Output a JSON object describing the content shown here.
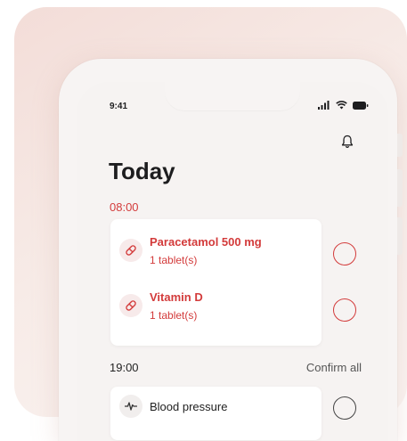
{
  "status_bar": {
    "time": "9:41",
    "signal_icon": "signal-bars-icon",
    "wifi_icon": "wifi-icon",
    "battery_icon": "battery-icon"
  },
  "header": {
    "title": "Today",
    "bell_icon": "bell-icon"
  },
  "colors": {
    "accent": "#d33b3b",
    "text": "#1d1d1f",
    "muted": "#555555",
    "check_neutral": "#444444"
  },
  "groups": [
    {
      "time": "08:00",
      "items": [
        {
          "name": "Paracetamol 500 mg",
          "dose": "1 tablet(s)",
          "icon": "pill-icon"
        },
        {
          "name": "Vitamin D",
          "dose": "1 tablet(s)",
          "icon": "pill-icon"
        }
      ]
    },
    {
      "time": "19:00",
      "confirm_all": "Confirm all",
      "items": [
        {
          "name": "Blood pressure",
          "icon": "pulse-icon"
        }
      ]
    }
  ]
}
